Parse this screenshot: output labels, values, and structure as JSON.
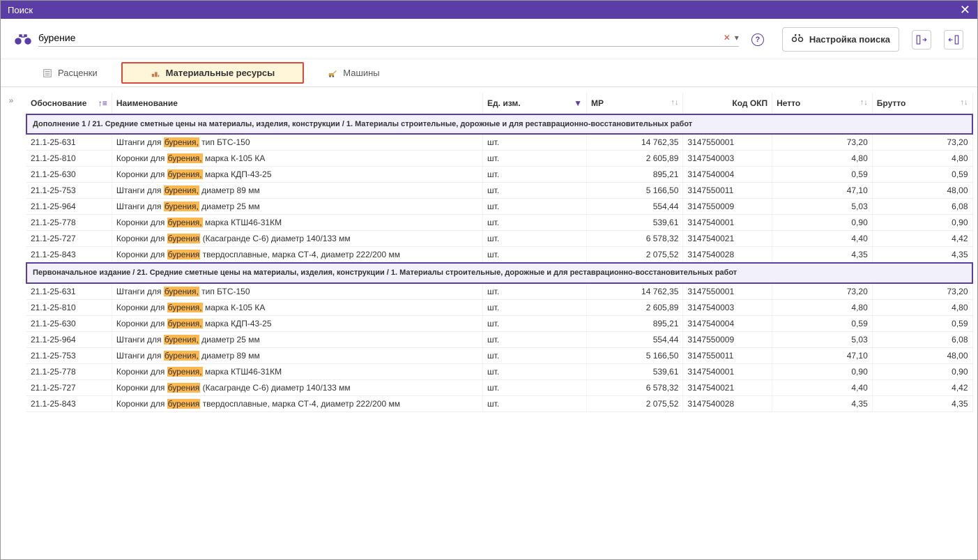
{
  "window": {
    "title": "Поиск",
    "close": "✕"
  },
  "search": {
    "value": "бурение",
    "clear": "✕",
    "dropdown": "▾",
    "help": "?",
    "settings_btn": "Настройка поиска"
  },
  "tabs": {
    "pricing": "Расценки",
    "materials": "Материальные ресурсы",
    "machines": "Машины"
  },
  "expander": "»",
  "columns": {
    "obosn": "Обоснование",
    "name": "Наименование",
    "unit": "Ед. изм.",
    "mr": "МР",
    "okp": "Код ОКП",
    "netto": "Нетто",
    "brutto": "Брутто"
  },
  "groups": [
    {
      "title": "Дополнение 1 / 21. Средние сметные цены на материалы, изделия, конструкции / 1. Материалы строительные, дорожные и для реставрационно-восстановительных работ",
      "rows": [
        {
          "obosn": "21.1-25-631",
          "pre": "Штанги для ",
          "hl": "бурения,",
          "post": " тип БТС-150",
          "unit": "шт.",
          "mr": "14 762,35",
          "okp": "3147550001",
          "netto": "73,20",
          "brutto": "73,20"
        },
        {
          "obosn": "21.1-25-810",
          "pre": "Коронки для ",
          "hl": "бурения,",
          "post": " марка К-105 КА",
          "unit": "шт.",
          "mr": "2 605,89",
          "okp": "3147540003",
          "netto": "4,80",
          "brutto": "4,80"
        },
        {
          "obosn": "21.1-25-630",
          "pre": "Коронки для ",
          "hl": "бурения,",
          "post": " марка КДП-43-25",
          "unit": "шт.",
          "mr": "895,21",
          "okp": "3147540004",
          "netto": "0,59",
          "brutto": "0,59"
        },
        {
          "obosn": "21.1-25-753",
          "pre": "Штанги для ",
          "hl": "бурения,",
          "post": " диаметр 89 мм",
          "unit": "шт.",
          "mr": "5 166,50",
          "okp": "3147550011",
          "netto": "47,10",
          "brutto": "48,00"
        },
        {
          "obosn": "21.1-25-964",
          "pre": "Штанги для ",
          "hl": "бурения,",
          "post": " диаметр 25 мм",
          "unit": "шт.",
          "mr": "554,44",
          "okp": "3147550009",
          "netto": "5,03",
          "brutto": "6,08"
        },
        {
          "obosn": "21.1-25-778",
          "pre": "Коронки для ",
          "hl": "бурения,",
          "post": " марка КТШ46-31КМ",
          "unit": "шт.",
          "mr": "539,61",
          "okp": "3147540001",
          "netto": "0,90",
          "brutto": "0,90"
        },
        {
          "obosn": "21.1-25-727",
          "pre": "Коронки для ",
          "hl": "бурения",
          "post": " (Касагранде С-6) диаметр 140/133 мм",
          "unit": "шт.",
          "mr": "6 578,32",
          "okp": "3147540021",
          "netto": "4,40",
          "brutto": "4,42"
        },
        {
          "obosn": "21.1-25-843",
          "pre": "Коронки для ",
          "hl": "бурения",
          "post": " твердосплавные, марка СТ-4, диаметр 222/200 мм",
          "unit": "шт.",
          "mr": "2 075,52",
          "okp": "3147540028",
          "netto": "4,35",
          "brutto": "4,35"
        }
      ]
    },
    {
      "title": "Первоначальное издание / 21. Средние сметные цены на материалы, изделия, конструкции / 1. Материалы строительные, дорожные и для реставрационно-восстановительных работ",
      "rows": [
        {
          "obosn": "21.1-25-631",
          "pre": "Штанги для ",
          "hl": "бурения,",
          "post": " тип БТС-150",
          "unit": "шт.",
          "mr": "14 762,35",
          "okp": "3147550001",
          "netto": "73,20",
          "brutto": "73,20"
        },
        {
          "obosn": "21.1-25-810",
          "pre": "Коронки для ",
          "hl": "бурения,",
          "post": " марка К-105 КА",
          "unit": "шт.",
          "mr": "2 605,89",
          "okp": "3147540003",
          "netto": "4,80",
          "brutto": "4,80"
        },
        {
          "obosn": "21.1-25-630",
          "pre": "Коронки для ",
          "hl": "бурения,",
          "post": " марка КДП-43-25",
          "unit": "шт.",
          "mr": "895,21",
          "okp": "3147540004",
          "netto": "0,59",
          "brutto": "0,59"
        },
        {
          "obosn": "21.1-25-964",
          "pre": "Штанги для ",
          "hl": "бурения,",
          "post": " диаметр 25 мм",
          "unit": "шт.",
          "mr": "554,44",
          "okp": "3147550009",
          "netto": "5,03",
          "brutto": "6,08"
        },
        {
          "obosn": "21.1-25-753",
          "pre": "Штанги для ",
          "hl": "бурения,",
          "post": " диаметр 89 мм",
          "unit": "шт.",
          "mr": "5 166,50",
          "okp": "3147550011",
          "netto": "47,10",
          "brutto": "48,00"
        },
        {
          "obosn": "21.1-25-778",
          "pre": "Коронки для ",
          "hl": "бурения,",
          "post": " марка КТШ46-31КМ",
          "unit": "шт.",
          "mr": "539,61",
          "okp": "3147540001",
          "netto": "0,90",
          "brutto": "0,90"
        },
        {
          "obosn": "21.1-25-727",
          "pre": "Коронки для ",
          "hl": "бурения",
          "post": " (Касагранде С-6) диаметр 140/133 мм",
          "unit": "шт.",
          "mr": "6 578,32",
          "okp": "3147540021",
          "netto": "4,40",
          "brutto": "4,42"
        },
        {
          "obosn": "21.1-25-843",
          "pre": "Коронки для ",
          "hl": "бурения",
          "post": " твердосплавные, марка СТ-4, диаметр 222/200 мм",
          "unit": "шт.",
          "mr": "2 075,52",
          "okp": "3147540028",
          "netto": "4,35",
          "brutto": "4,35"
        }
      ]
    }
  ]
}
